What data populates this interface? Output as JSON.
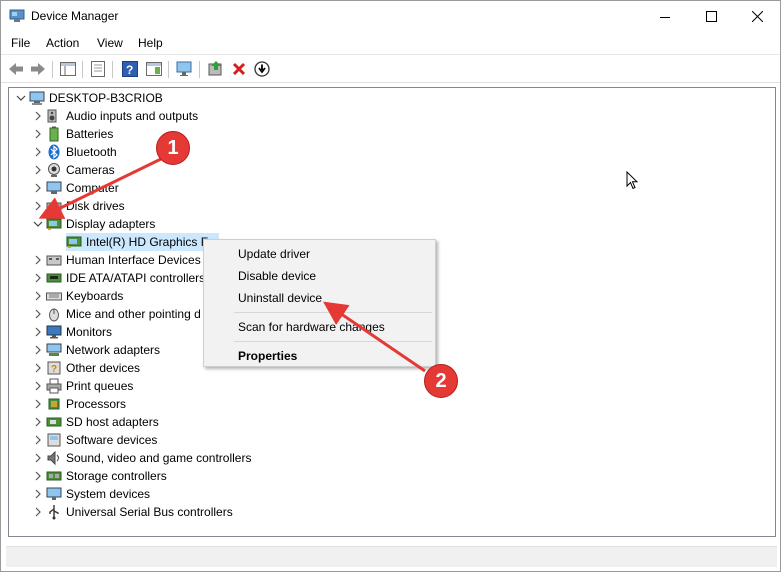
{
  "window": {
    "title": "Device Manager"
  },
  "menu": [
    "File",
    "Action",
    "View",
    "Help"
  ],
  "tree": {
    "root": "DESKTOP-B3CRIOB",
    "categories": [
      {
        "label": "Audio inputs and outputs",
        "icon": "speaker-icon",
        "expanded": false
      },
      {
        "label": "Batteries",
        "icon": "battery-icon",
        "expanded": false
      },
      {
        "label": "Bluetooth",
        "icon": "bluetooth-icon",
        "expanded": false
      },
      {
        "label": "Cameras",
        "icon": "camera-icon",
        "expanded": false
      },
      {
        "label": "Computer",
        "icon": "computer-icon",
        "expanded": false
      },
      {
        "label": "Disk drives",
        "icon": "disk-drive-icon",
        "expanded": false
      },
      {
        "label": "Display adapters",
        "icon": "display-adapter-icon",
        "expanded": true,
        "children": [
          {
            "label": "Intel(R) HD Graphics Fa",
            "icon": "display-adapter-icon",
            "selected": true
          }
        ]
      },
      {
        "label": "Human Interface Devices",
        "icon": "hid-icon",
        "expanded": false
      },
      {
        "label": "IDE ATA/ATAPI controllers",
        "icon": "ide-controller-icon",
        "expanded": false
      },
      {
        "label": "Keyboards",
        "icon": "keyboard-icon",
        "expanded": false
      },
      {
        "label": "Mice and other pointing d",
        "icon": "mouse-icon",
        "expanded": false
      },
      {
        "label": "Monitors",
        "icon": "monitor-icon",
        "expanded": false
      },
      {
        "label": "Network adapters",
        "icon": "network-adapter-icon",
        "expanded": false
      },
      {
        "label": "Other devices",
        "icon": "other-devices-icon",
        "expanded": false
      },
      {
        "label": "Print queues",
        "icon": "printer-icon",
        "expanded": false
      },
      {
        "label": "Processors",
        "icon": "processor-icon",
        "expanded": false
      },
      {
        "label": "SD host adapters",
        "icon": "sd-host-icon",
        "expanded": false
      },
      {
        "label": "Software devices",
        "icon": "software-device-icon",
        "expanded": false
      },
      {
        "label": "Sound, video and game controllers",
        "icon": "sound-icon",
        "expanded": false
      },
      {
        "label": "Storage controllers",
        "icon": "storage-controller-icon",
        "expanded": false
      },
      {
        "label": "System devices",
        "icon": "system-device-icon",
        "expanded": false
      },
      {
        "label": "Universal Serial Bus controllers",
        "icon": "usb-icon",
        "expanded": false
      }
    ]
  },
  "context_menu": {
    "items": [
      "Update driver",
      "Disable device",
      "Uninstall device",
      "Scan for hardware changes",
      "Properties"
    ]
  },
  "annotations": {
    "badge1": "1",
    "badge2": "2"
  },
  "colors": {
    "selection": "#cce8ff",
    "annotation": "#e53935",
    "menu_bg": "#f2f2f2"
  }
}
